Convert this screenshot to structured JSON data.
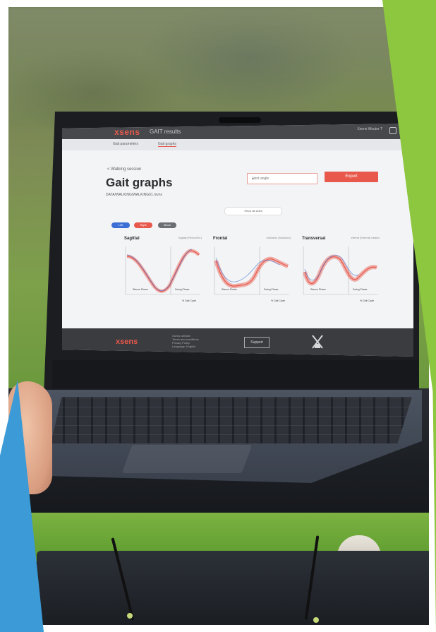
{
  "app": {
    "brand": "xsens",
    "product": "GAIT results",
    "user_label": "Xsens Wouter T",
    "nav_items": [
      "Gait parameters",
      "Gait graphs"
    ]
  },
  "page": {
    "back_link": "< Walking session",
    "title": "Gait graphs",
    "file_name": "DATA/WALKING/WALKING01.mvnx",
    "dropdown_value": "Joint angle",
    "export_label": "Export",
    "show_all_label": "Show all sides",
    "pills": [
      "Left",
      "Right",
      "Mean"
    ]
  },
  "charts": [
    {
      "title": "Sagittal",
      "subtitle": "Sagittal (Flexion/Ext.)",
      "stance": "Stance Phase",
      "swing": "Swing Phase",
      "xlabel": "% Gait Cycle"
    },
    {
      "title": "Frontal",
      "subtitle": "Adduction (Abduction)",
      "stance": "Stance Phase",
      "swing": "Swing Phase",
      "xlabel": "% Gait Cycle"
    },
    {
      "title": "Transversal",
      "subtitle": "Internal (External) rotation",
      "stance": "Stance Phase",
      "swing": "Swing Phase",
      "xlabel": "% Gait Cycle"
    }
  ],
  "footer": {
    "brand": "xsens",
    "links": "Xsens website\nTerms and conditions\nPrivacy Policy\nLanguage: English",
    "support_label": "Support"
  },
  "colors": {
    "accent": "#e8584b",
    "green": "#8dc63f",
    "blue": "#3c9ad6",
    "left_series": "#3b6fd6",
    "right_series": "#e8584b"
  }
}
